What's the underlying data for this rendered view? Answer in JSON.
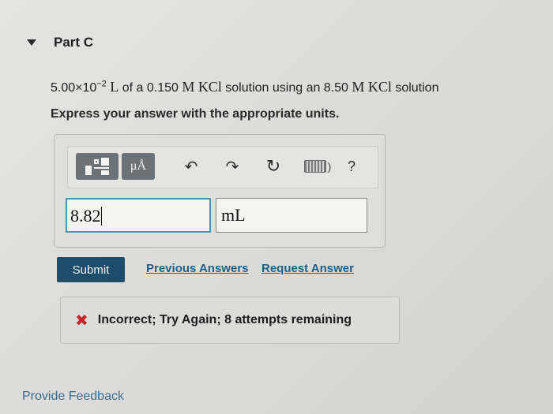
{
  "part": {
    "title": "Part C"
  },
  "question": {
    "prefix": "5.00×10",
    "exponent": "−2",
    "unit_l": "L",
    "text_of_a": " of a 0.150 ",
    "conc_unit_1": "M",
    "compound_1": "KCl",
    "text_solution_using": " solution using an 8.50 ",
    "conc_unit_2": "M",
    "compound_2": "KCl",
    "text_solution": " solution"
  },
  "instruction": "Express your answer with the appropriate units.",
  "toolbar": {
    "units_label": "μÅ",
    "undo_glyph": "↶",
    "redo_glyph": "↷",
    "reset_glyph": "↻",
    "help_label": "?",
    "keyboard_bracket": ")"
  },
  "answer": {
    "value": "8.82",
    "unit": "mL"
  },
  "actions": {
    "submit_label": "Submit",
    "previous_answers_label": "Previous Answers",
    "request_answer_label": "Request Answer"
  },
  "feedback": {
    "icon_glyph": "✖",
    "message": "Incorrect; Try Again; 8 attempts remaining"
  },
  "footer": {
    "provide_feedback_label": "Provide Feedback"
  },
  "colors": {
    "submit_bg": "#1d4d6a",
    "link": "#1f5f86",
    "error_icon": "#c0282d",
    "active_input_border": "#4f91b8"
  }
}
